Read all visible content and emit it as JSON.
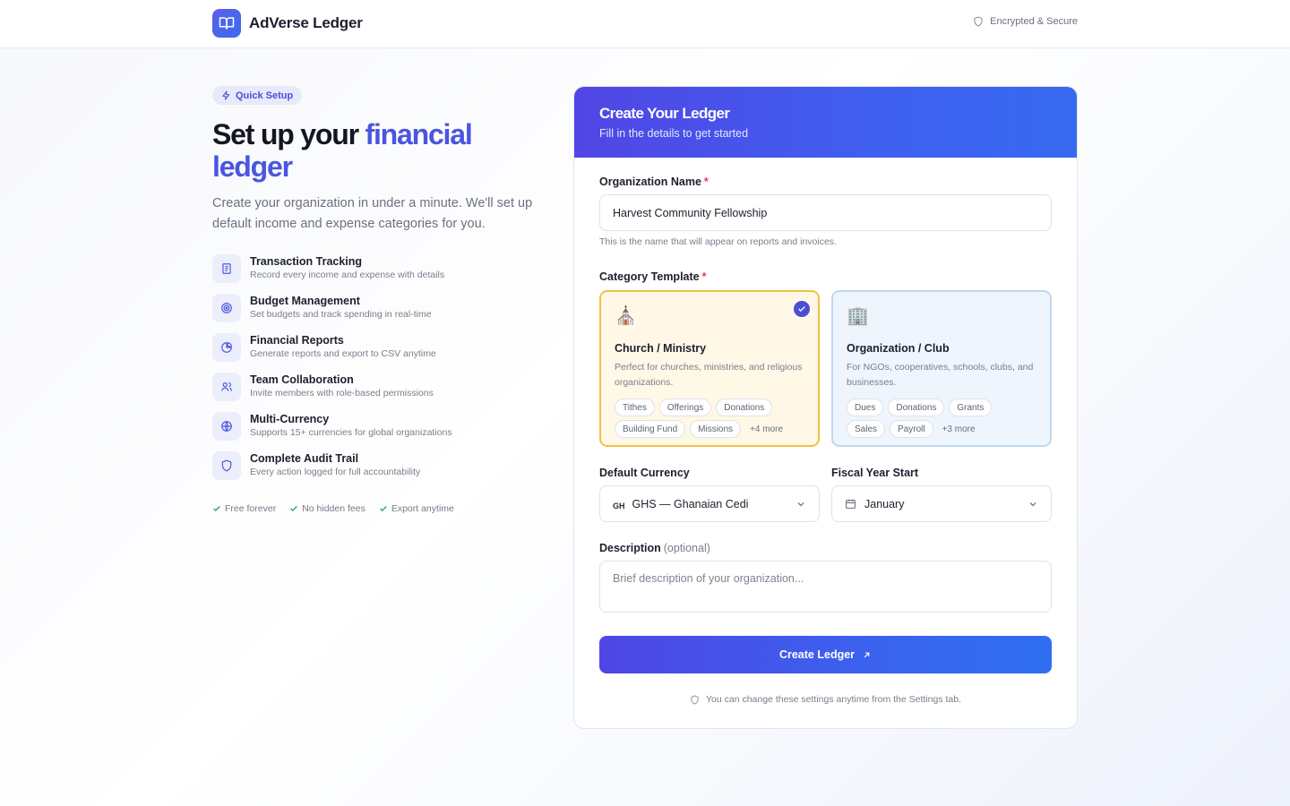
{
  "app": {
    "name": "AdVerse Ledger",
    "secure_label": "Encrypted & Secure"
  },
  "intro": {
    "badge": "Quick Setup",
    "headline_plain": "Set up your ",
    "headline_accent": "financial ledger",
    "lead": "Create your organization in under a minute. We'll set up default income and expense categories for you.",
    "features": [
      {
        "title": "Transaction Tracking",
        "subtitle": "Record every income and expense with details",
        "icon": "receipt-icon"
      },
      {
        "title": "Budget Management",
        "subtitle": "Set budgets and track spending in real-time",
        "icon": "target-icon"
      },
      {
        "title": "Financial Reports",
        "subtitle": "Generate reports and export to CSV anytime",
        "icon": "pie-chart-icon"
      },
      {
        "title": "Team Collaboration",
        "subtitle": "Invite members with role-based permissions",
        "icon": "users-icon"
      },
      {
        "title": "Multi-Currency",
        "subtitle": "Supports 15+ currencies for global organizations",
        "icon": "globe-icon"
      },
      {
        "title": "Complete Audit Trail",
        "subtitle": "Every action logged for full accountability",
        "icon": "shield-icon"
      }
    ],
    "perks": [
      "Free forever",
      "No hidden fees",
      "Export anytime"
    ]
  },
  "form": {
    "title": "Create Your Ledger",
    "subtitle": "Fill in the details to get started",
    "org_name": {
      "label": "Organization Name",
      "required_mark": "*",
      "value": "Harvest Community Fellowship",
      "hint": "This is the name that will appear on reports and invoices."
    },
    "template": {
      "label": "Category Template",
      "required_mark": "*",
      "options": [
        {
          "emoji": "⛪",
          "name": "Church / Ministry",
          "description": "Perfect for churches, ministries, and religious organizations.",
          "chips": [
            "Tithes",
            "Offerings",
            "Donations",
            "Building Fund",
            "Missions"
          ],
          "more": "+4 more",
          "selected": true
        },
        {
          "emoji": "🏢",
          "name": "Organization / Club",
          "description": "For NGOs, cooperatives, schools, clubs, and businesses.",
          "chips": [
            "Dues",
            "Donations",
            "Grants",
            "Sales",
            "Payroll"
          ],
          "more": "+3 more",
          "selected": false
        }
      ]
    },
    "currency": {
      "label": "Default Currency",
      "code_badge": "GH",
      "value": "GHS — Ghanaian Cedi"
    },
    "fiscal_year": {
      "label": "Fiscal Year Start",
      "value": "January"
    },
    "description": {
      "label": "Description",
      "optional": "(optional)",
      "placeholder": "Brief description of your organization..."
    },
    "submit_label": "Create Ledger",
    "footnote": "You can change these settings anytime from the Settings tab."
  },
  "colors": {
    "accent": "#4a55e0",
    "gradient_start": "#5146e5",
    "gradient_end": "#3769f0",
    "selected_border": "#f2c043",
    "required": "#e0414c",
    "check": "#22a06b"
  }
}
